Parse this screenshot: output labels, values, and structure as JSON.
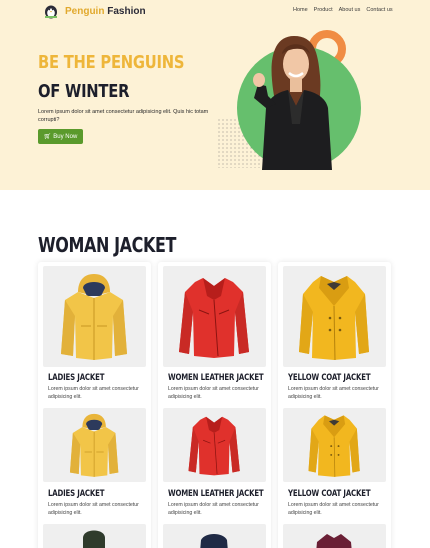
{
  "brand": {
    "word1": "Penguin",
    "word2": "Fashion"
  },
  "nav": [
    "Home",
    "Product",
    "About us",
    "Contact us"
  ],
  "hero": {
    "line1": "BE THE PENGUINS",
    "line2": "OF WINTER",
    "description": "Lorem ipsum dolor sit amet consectetur adipisicing elit. Quis hic totam corrupti?",
    "button": "Buy Now"
  },
  "section": {
    "title": "WOMAN JACKET"
  },
  "products": [
    {
      "name": "LADIES JACKET",
      "desc": "Lorem ipsum dolor sit amet consectetur adipisicing elit."
    },
    {
      "name": "WOMEN LEATHER JACKET",
      "desc": "Lorem ipsum dolor sit amet consectetur adipisicing elit."
    },
    {
      "name": "YELLOW COAT JACKET",
      "desc": "Lorem ipsum dolor sit amet consectetur adipisicing elit."
    },
    {
      "name": "LADIES JACKET",
      "desc": "Lorem ipsum dolor sit amet consectetur adipisicing elit."
    },
    {
      "name": "WOMEN LEATHER JACKET",
      "desc": "Lorem ipsum dolor sit amet consectetur adipisicing elit."
    },
    {
      "name": "YELLOW COAT JACKET",
      "desc": "Lorem ipsum dolor sit amet consectetur adipisicing elit."
    }
  ],
  "colors": {
    "hero_bg": "#fdf2d6",
    "accent_yellow": "#eeb63a",
    "button_green": "#5a9a2c",
    "disc_green": "#66bf6d",
    "ring_orange": "#f08c43"
  },
  "icons": {
    "logo": "penguin-logo-icon",
    "cart": "cart-icon"
  }
}
